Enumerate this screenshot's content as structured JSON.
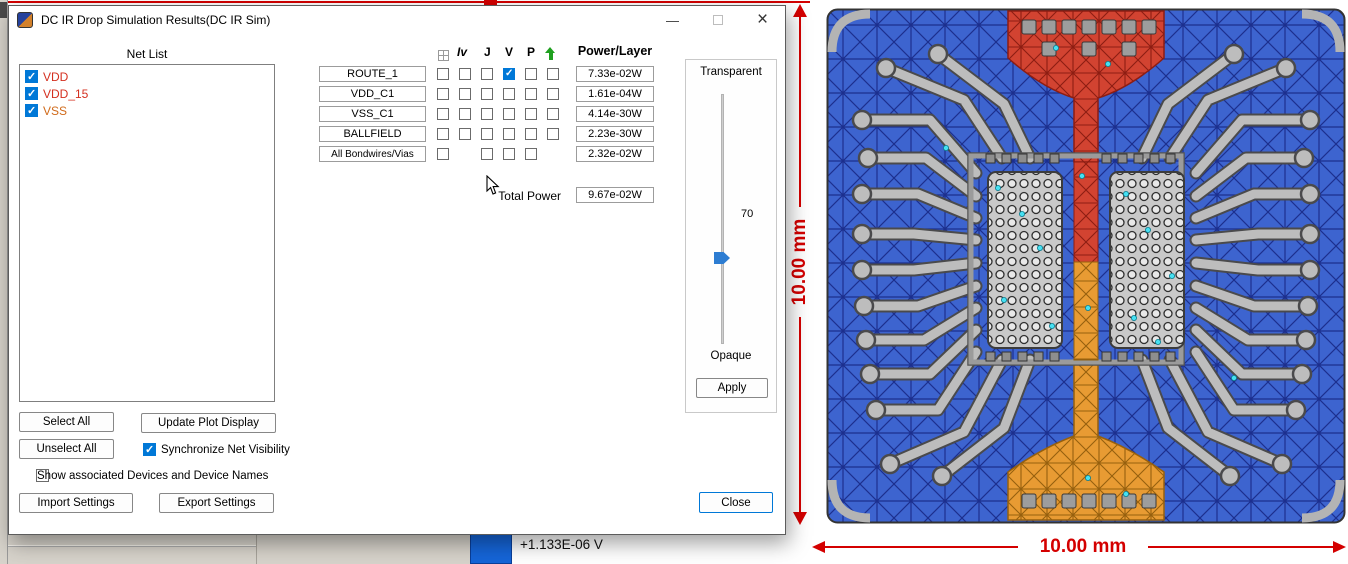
{
  "window": {
    "title": "DC IR Drop Simulation Results(DC IR Sim)",
    "controls": {
      "minimize": "—",
      "close": "×"
    }
  },
  "net_list": {
    "label": "Net List",
    "items": [
      {
        "name": "VDD",
        "checked": true,
        "color": "#d42f1f"
      },
      {
        "name": "VDD_15",
        "checked": true,
        "color": "#d42f1f"
      },
      {
        "name": "VSS",
        "checked": true,
        "color": "#d06a1a"
      }
    ]
  },
  "actions": {
    "select_all": "Select All",
    "unselect_all": "Unselect All",
    "update_plot_display": "Update Plot Display",
    "synchronize_net_visibility": {
      "label": "Synchronize Net Visibility",
      "checked": true
    },
    "show_associated_devices": {
      "label": "Show associated Devices and Device Names",
      "checked": false
    },
    "import_settings": "Import Settings",
    "export_settings": "Export Settings",
    "close": "Close"
  },
  "layer_table": {
    "headers": {
      "iv": "Iv",
      "j": "J",
      "v": "V",
      "p": "P",
      "power_layer": "Power/Layer"
    },
    "rows": [
      {
        "label": "ROUTE_1",
        "power": "7.33e-02W",
        "checks": {
          "grid": false,
          "iv": false,
          "j": false,
          "v": true,
          "p": false,
          "up": false
        }
      },
      {
        "label": "VDD_C1",
        "power": "1.61e-04W",
        "checks": {
          "grid": false,
          "iv": false,
          "j": false,
          "v": false,
          "p": false,
          "up": false
        }
      },
      {
        "label": "VSS_C1",
        "power": "4.14e-30W",
        "checks": {
          "grid": false,
          "iv": false,
          "j": false,
          "v": false,
          "p": false,
          "up": false
        }
      },
      {
        "label": "BALLFIELD",
        "power": "2.23e-30W",
        "checks": {
          "grid": false,
          "iv": false,
          "j": false,
          "v": false,
          "p": false,
          "up": false
        }
      },
      {
        "label": "All Bondwires/Vias",
        "power": "2.32e-02W",
        "checks": {
          "grid": false,
          "j": false,
          "v": false,
          "p": false
        }
      }
    ],
    "total_power_label": "Total Power",
    "total_power_value": "9.67e-02W"
  },
  "transparency_panel": {
    "top_label": "Transparent",
    "value": "70",
    "bottom_label": "Opaque",
    "apply": "Apply"
  },
  "status_bar": {
    "voltage_reading": "+1.133E-06 V"
  },
  "dimensions": {
    "vertical_label": "10.00 mm",
    "horizontal_label": "10.00 mm",
    "color": "#d40000"
  },
  "icons": {
    "layer_visibility_column": "grid-icon",
    "power_up_column": "up-arrow-icon",
    "app": "app-icon",
    "pointer": "mouse-cursor-icon"
  },
  "colors": {
    "accent_checked": "#0078d7",
    "mesh_blue": "#3d64cf",
    "mesh_red": "#d24331",
    "mesh_orange": "#e89b33"
  }
}
